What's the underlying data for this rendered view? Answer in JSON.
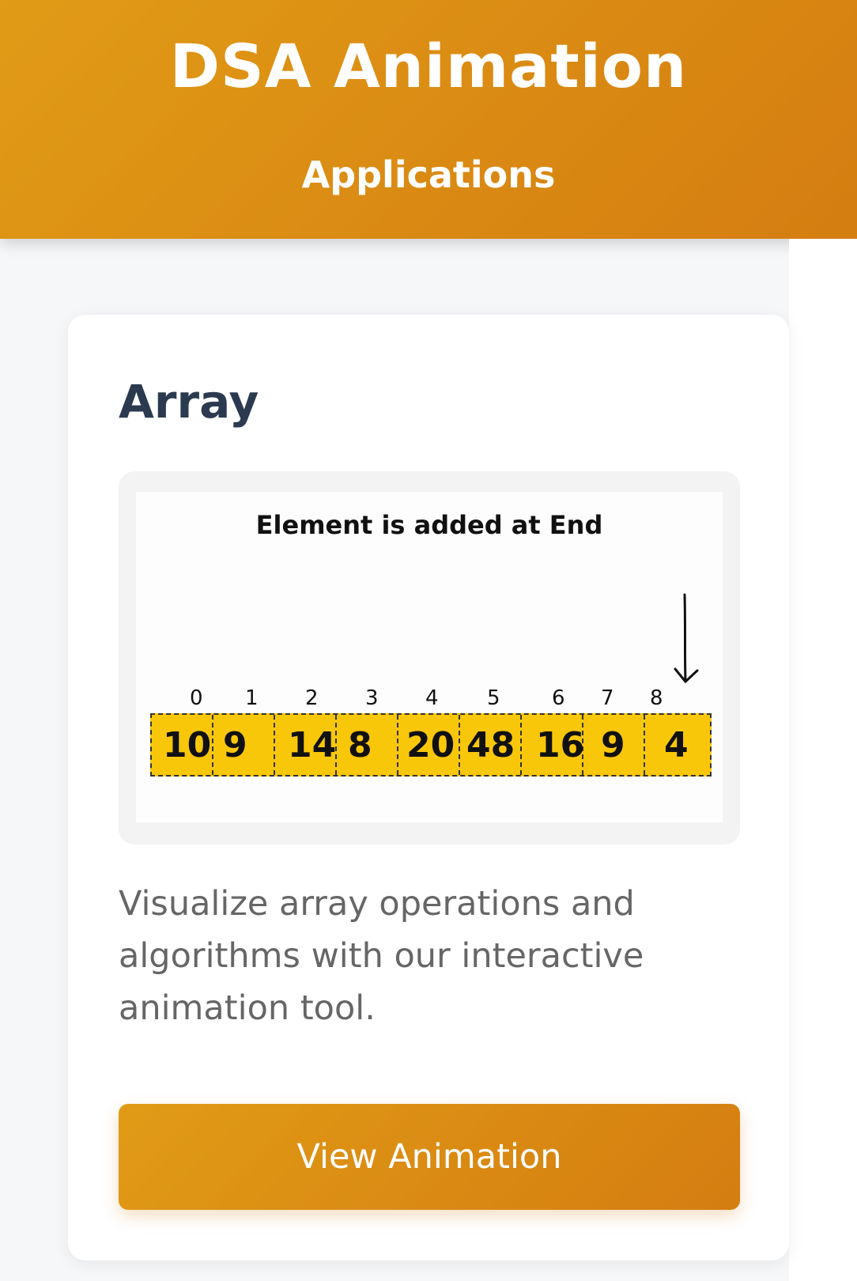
{
  "header": {
    "site_title": "DSA Animation",
    "section_title": "Applications",
    "gradient_start": "#e19b16",
    "gradient_end": "#d47d11"
  },
  "card": {
    "title": "Array",
    "preview": {
      "caption": "Element is added at End",
      "indices": [
        "0",
        "1",
        "2",
        "3",
        "4",
        "5",
        "6",
        "7",
        "8"
      ],
      "values": [
        "10",
        "9",
        "14",
        "8",
        "20",
        "48",
        "16",
        "9",
        "4"
      ],
      "pointer_icon": "down-arrow-icon",
      "cell_color": "#f8c70a"
    },
    "description": "Visualize array operations and algorithms with our interactive animation tool.",
    "button_label": "View Animation"
  }
}
